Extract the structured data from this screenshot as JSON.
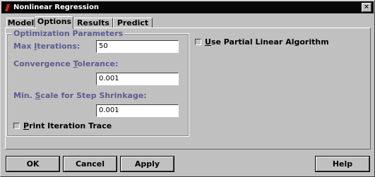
{
  "window": {
    "title": "Nonlinear Regression",
    "close_glyph": "×"
  },
  "tabs": [
    {
      "label": "Model",
      "active": false
    },
    {
      "label": "Options",
      "active": true
    },
    {
      "label": "Results",
      "active": false
    },
    {
      "label": "Predict",
      "active": false
    }
  ],
  "optimization": {
    "group_title": "Optimization Parameters",
    "max_iterations": {
      "label_pre": "Max ",
      "label_u": "I",
      "label_post": "terations:",
      "value": "50"
    },
    "convergence_tolerance": {
      "label_pre": "Convergence ",
      "label_u": "T",
      "label_post": "olerance:",
      "value": "0.001"
    },
    "min_scale": {
      "label_pre": "Min. ",
      "label_u": "S",
      "label_post": "cale for Step Shrinkage:",
      "value": "0.001"
    },
    "print_trace": {
      "label_pre": "",
      "label_u": "P",
      "label_post": "rint Iteration Trace",
      "checked": false
    }
  },
  "partial_linear": {
    "label_pre": "",
    "label_u": "U",
    "label_post": "se Partial Linear Algorithm",
    "checked": false
  },
  "buttons": {
    "ok": "OK",
    "cancel": "Cancel",
    "apply": "Apply",
    "help": "Help"
  }
}
